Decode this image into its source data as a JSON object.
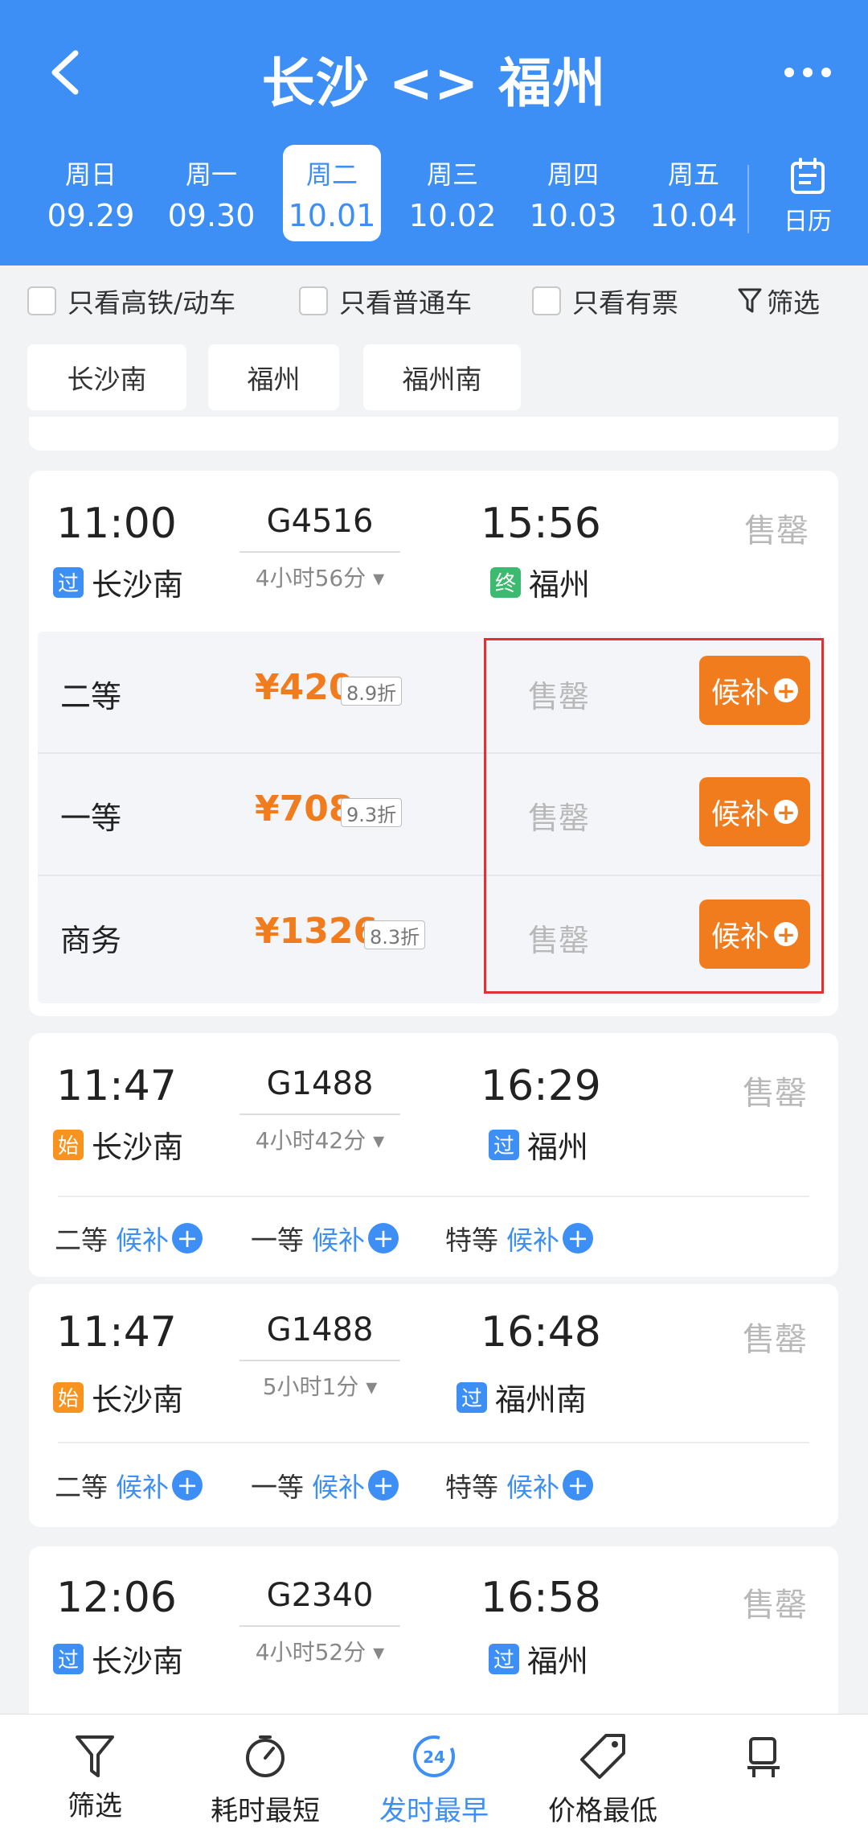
{
  "header": {
    "title": "长沙 <> 福州"
  },
  "dates": [
    {
      "weekday": "周日",
      "date": "09.29"
    },
    {
      "weekday": "周一",
      "date": "09.30"
    },
    {
      "weekday": "周二",
      "date": "10.01"
    },
    {
      "weekday": "周三",
      "date": "10.02"
    },
    {
      "weekday": "周四",
      "date": "10.03"
    },
    {
      "weekday": "周五",
      "date": "10.04"
    }
  ],
  "calendar_label": "日历",
  "filters": {
    "hsr_only": "只看高铁/动车",
    "normal_only": "只看普通车",
    "available_only": "只看有票",
    "filter": "筛选"
  },
  "stations": [
    "长沙南",
    "福州",
    "福州南"
  ],
  "trains": [
    {
      "dep": "11:00",
      "no": "G4516",
      "arr": "15:56",
      "duration": "4小时56分",
      "from_tag": "过",
      "from": "长沙南",
      "to_tag": "终",
      "to": "福州",
      "status": "售罄",
      "seats": [
        {
          "name": "二等",
          "price": "¥420",
          "discount": "8.9折",
          "status": "售罄",
          "action": "候补"
        },
        {
          "name": "一等",
          "price": "¥708",
          "discount": "9.3折",
          "status": "售罄",
          "action": "候补"
        },
        {
          "name": "商务",
          "price": "¥1326",
          "discount": "8.3折",
          "status": "售罄",
          "action": "候补"
        }
      ]
    },
    {
      "dep": "11:47",
      "no": "G1488",
      "arr": "16:29",
      "duration": "4小时42分",
      "from_tag": "始",
      "from": "长沙南",
      "to_tag": "过",
      "to": "福州",
      "status": "售罄",
      "seats": [
        {
          "name": "二等",
          "action": "候补"
        },
        {
          "name": "一等",
          "action": "候补"
        },
        {
          "name": "特等",
          "action": "候补"
        }
      ]
    },
    {
      "dep": "11:47",
      "no": "G1488",
      "arr": "16:48",
      "duration": "5小时1分",
      "from_tag": "始",
      "from": "长沙南",
      "to_tag": "过",
      "to": "福州南",
      "status": "售罄",
      "seats": [
        {
          "name": "二等",
          "action": "候补"
        },
        {
          "name": "一等",
          "action": "候补"
        },
        {
          "name": "特等",
          "action": "候补"
        }
      ]
    },
    {
      "dep": "12:06",
      "no": "G2340",
      "arr": "16:58",
      "duration": "4小时52分",
      "from_tag": "过",
      "from": "长沙南",
      "to_tag": "过",
      "to": "福州",
      "status": "售罄"
    }
  ],
  "bottom_bar": [
    {
      "label": "筛选",
      "icon": "filter-icon"
    },
    {
      "label": "耗时最短",
      "icon": "timer-icon"
    },
    {
      "label": "发时最早",
      "icon": "clock-24-icon",
      "badge": "24"
    },
    {
      "label": "价格最低",
      "icon": "price-tag-icon"
    }
  ],
  "colors": {
    "primary": "#3d8ff5",
    "orange": "#f07c1e",
    "green": "#3cba6f",
    "sold": "#b8b8b8",
    "highlight": "#e23030"
  }
}
